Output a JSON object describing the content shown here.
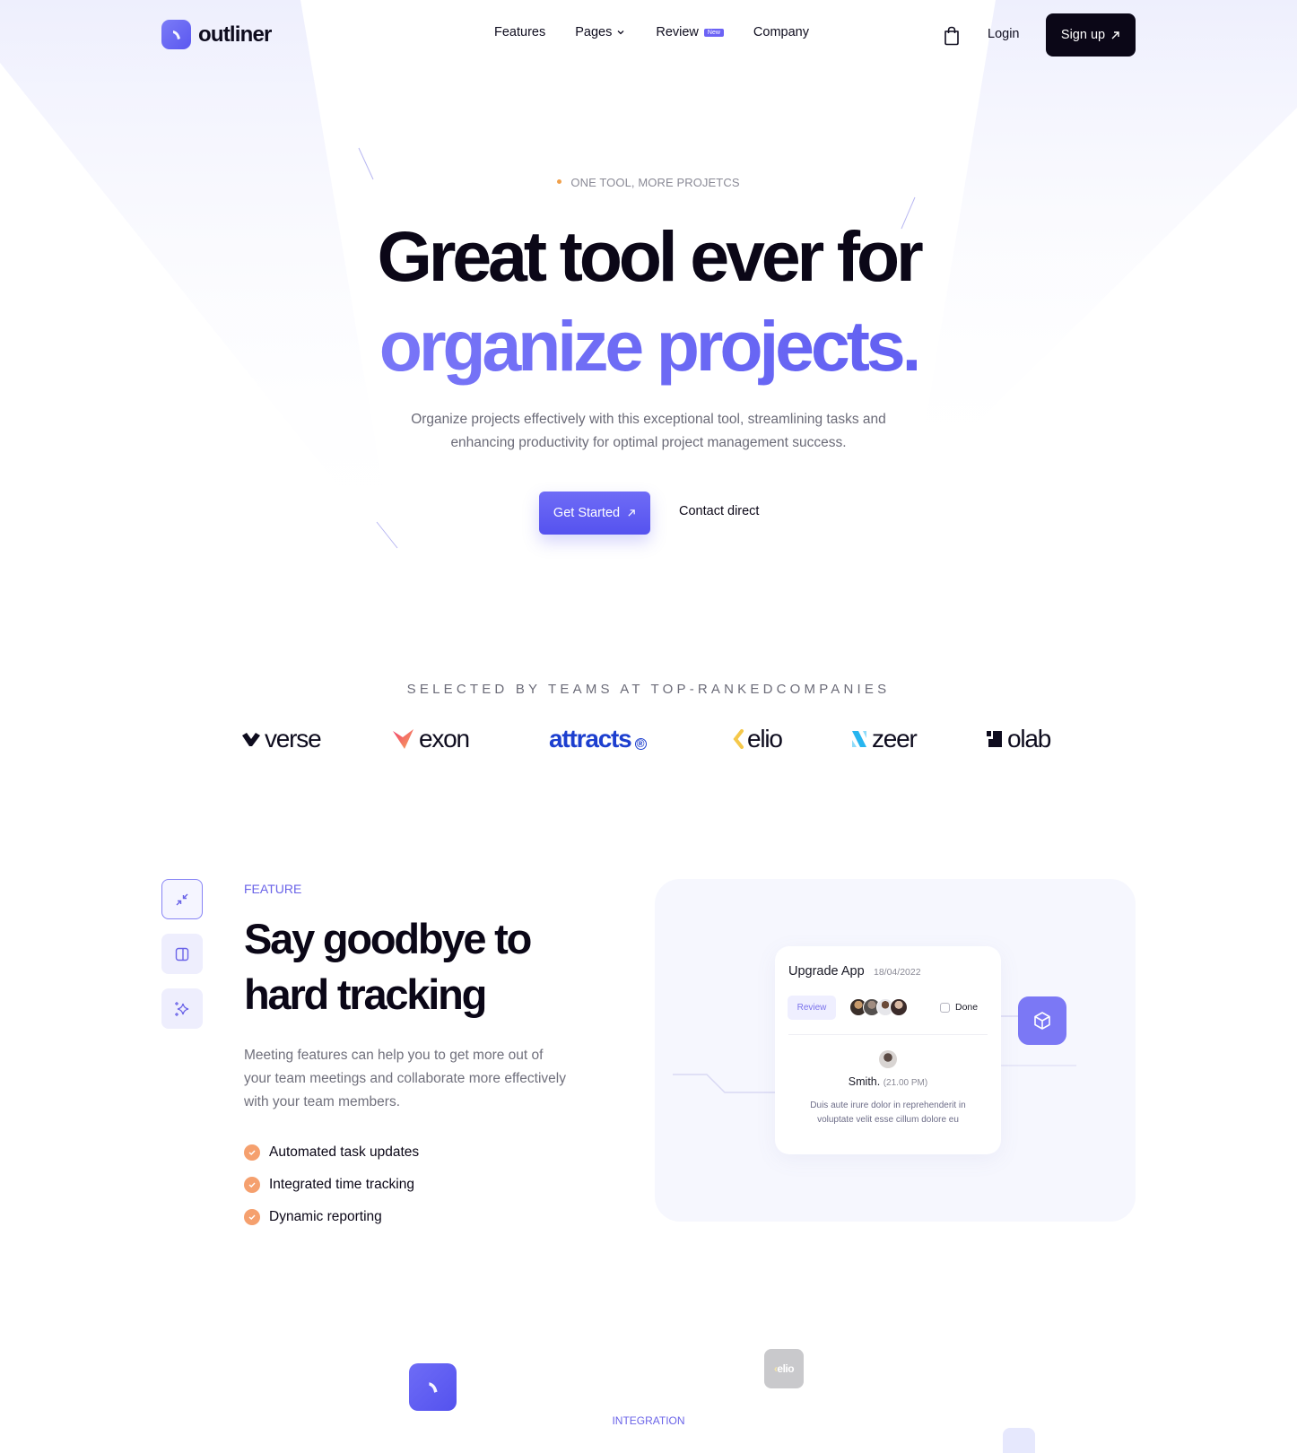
{
  "header": {
    "brand": "outliner",
    "nav": [
      {
        "label": "Features"
      },
      {
        "label": "Pages",
        "has_dropdown": true
      },
      {
        "label": "Review",
        "badge": "New"
      },
      {
        "label": "Company"
      }
    ],
    "login_label": "Login",
    "signup_label": "Sign up",
    "icons": {
      "cart": "shopping-bag-icon",
      "arrow": "arrow-up-right-icon",
      "chevron": "chevron-down-icon"
    }
  },
  "hero": {
    "eyebrow": "ONE TOOL, MORE PROJETCS",
    "title_line1": "Great tool ever for",
    "title_line2": "organize projects.",
    "subtitle": "Organize projects effectively with this exceptional tool, streamlining tasks and enhancing productivity for optimal project management success.",
    "primary_cta": "Get Started",
    "secondary_cta": "Contact direct"
  },
  "companies": {
    "label": "SELECTED BY TEAMS AT TOP-RANKEDCOMPANIES",
    "logos": [
      {
        "name": "verse",
        "color": "#0e0c1e"
      },
      {
        "name": "exon",
        "color": "#0e0c1e"
      },
      {
        "name": "attracts",
        "color": "#1d3fcf"
      },
      {
        "name": "elio",
        "color": "#0e0c1e"
      },
      {
        "name": "zeer",
        "color": "#0e0c1e"
      },
      {
        "name": "olab",
        "color": "#0e0c1e"
      }
    ]
  },
  "feature": {
    "label": "FEATURE",
    "title": "Say goodbye to hard tracking",
    "description": "Meeting features can help you to get more out of your team meetings and collaborate more effectively with your team members.",
    "bullets": [
      "Automated task updates",
      "Integrated time tracking",
      "Dynamic reporting"
    ],
    "side_icons": [
      "minimize-icon",
      "sidebar-panel-icon",
      "sparkles-icon"
    ],
    "card": {
      "title": "Upgrade App",
      "date": "18/04/2022",
      "status": "Review",
      "done_label": "Done",
      "done_checked": false,
      "commenter": "Smith.",
      "time": "(21.00 PM)",
      "message": "Duis aute irure dolor in reprehenderit in voluptate velit esse cillum dolore eu"
    }
  },
  "integration": {
    "label": "INTEGRATION",
    "elio_tile": "elio"
  },
  "colors": {
    "accent": "#5a57f0",
    "accent_light": "#8a86fb",
    "dark": "#0b0717",
    "check": "#f5a06e",
    "eyebrow_dot": "#f0a04b",
    "attracts_blue": "#1d3fcf"
  }
}
